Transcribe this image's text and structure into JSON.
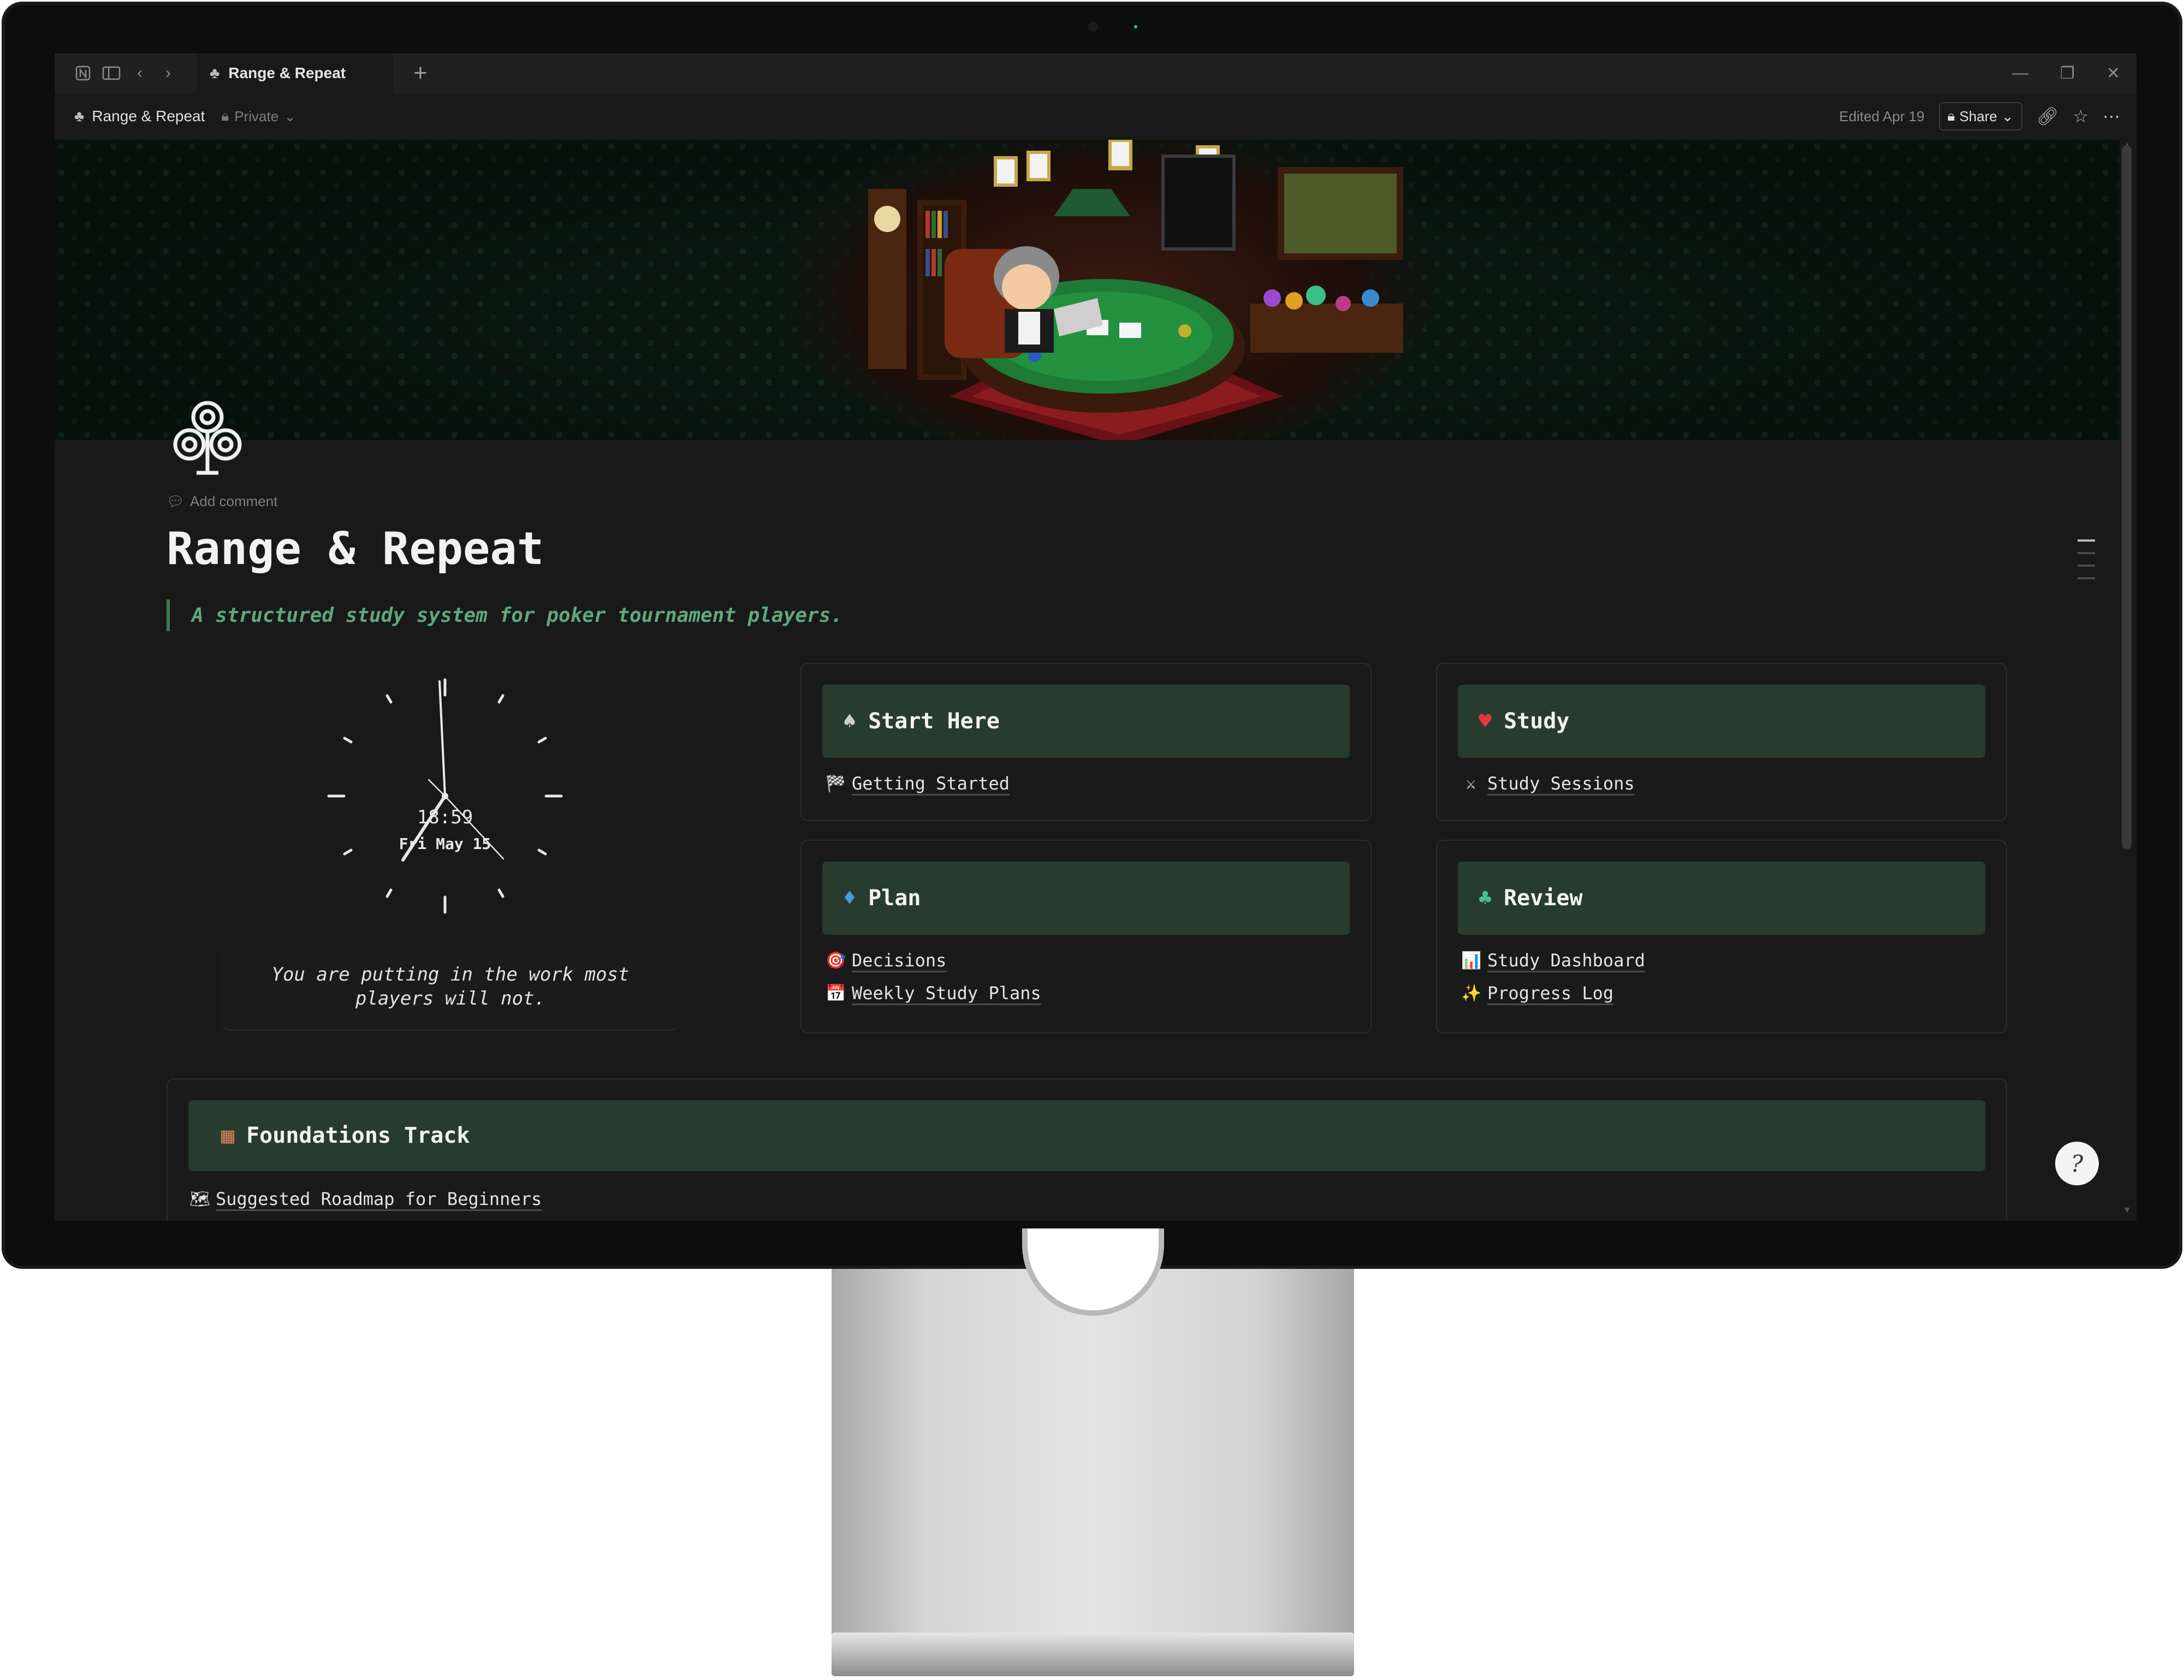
{
  "window": {
    "tab_title": "Range & Repeat",
    "new_tab": "+"
  },
  "toolbar": {
    "breadcrumb": "Range & Repeat",
    "privacy": "Private",
    "edited": "Edited Apr 19",
    "share_label": "Share"
  },
  "page": {
    "add_comment": "Add comment",
    "title": "Range & Repeat",
    "subtitle": "A structured study system for poker tournament players."
  },
  "clock": {
    "time": "18:59",
    "date": "Fri May 15"
  },
  "motto": "You are putting in the work most players will not.",
  "cards": {
    "start_here": {
      "title": "Start Here",
      "icon": "spade-icon",
      "links": [
        {
          "icon": "flag-icon",
          "label": "Getting Started"
        }
      ]
    },
    "study": {
      "title": "Study",
      "icon": "heart-icon",
      "links": [
        {
          "icon": "swords-icon",
          "label": "Study Sessions"
        }
      ]
    },
    "plan": {
      "title": "Plan",
      "icon": "diamond-icon",
      "links": [
        {
          "icon": "target-icon",
          "label": "Decisions"
        },
        {
          "icon": "calendar-icon",
          "label": "Weekly Study Plans"
        }
      ]
    },
    "review": {
      "title": "Review",
      "icon": "club-icon",
      "links": [
        {
          "icon": "chart-icon",
          "label": "Study Dashboard"
        },
        {
          "icon": "sparkle-icon",
          "label": "Progress Log"
        }
      ]
    },
    "foundations": {
      "title": "Foundations Track",
      "icon": "bricks-icon",
      "links": [
        {
          "icon": "map-icon",
          "label": "Suggested Roadmap for Beginners"
        }
      ]
    }
  },
  "colors": {
    "card_header": "#283b2f",
    "quote_accent": "#5ea87a",
    "background": "#191919"
  }
}
